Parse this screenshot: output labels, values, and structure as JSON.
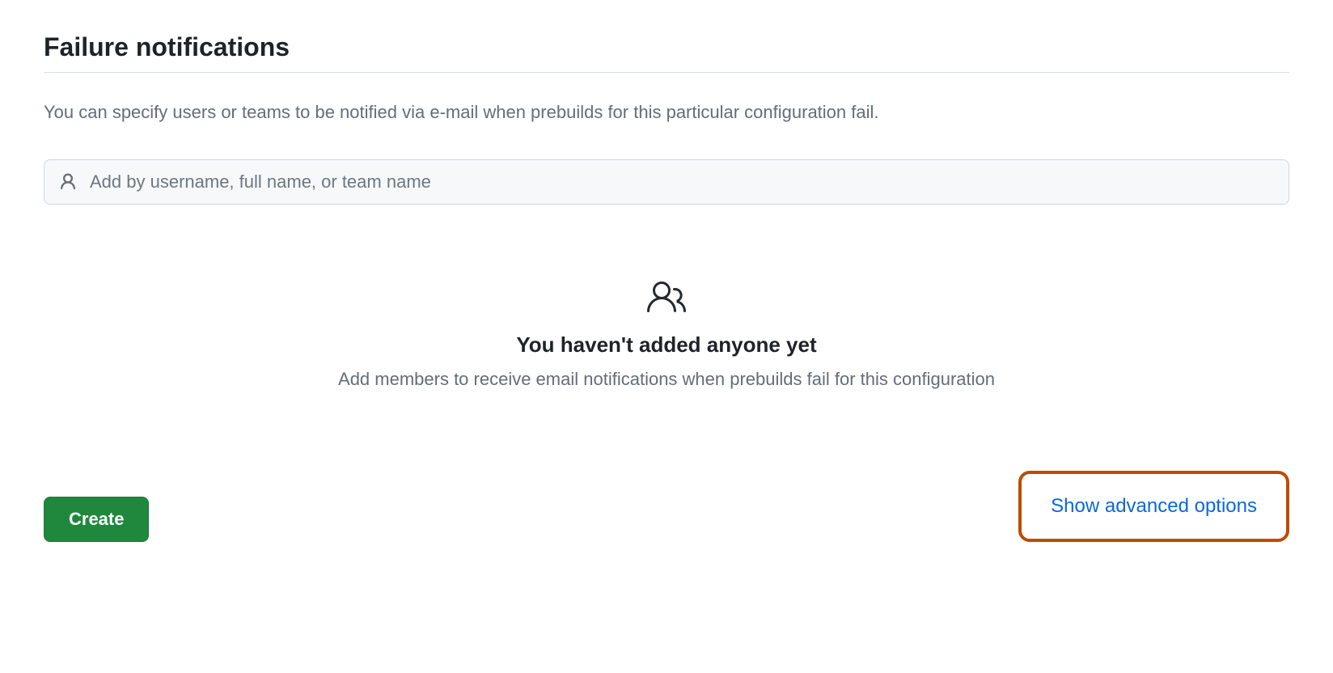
{
  "section": {
    "title": "Failure notifications",
    "description": "You can specify users or teams to be notified via e-mail when prebuilds for this particular configuration fail."
  },
  "input": {
    "placeholder": "Add by username, full name, or team name",
    "value": ""
  },
  "emptyState": {
    "title": "You haven't added anyone yet",
    "subtitle": "Add members to receive email notifications when prebuilds fail for this configuration"
  },
  "actions": {
    "create": "Create",
    "advancedOptions": "Show advanced options"
  }
}
